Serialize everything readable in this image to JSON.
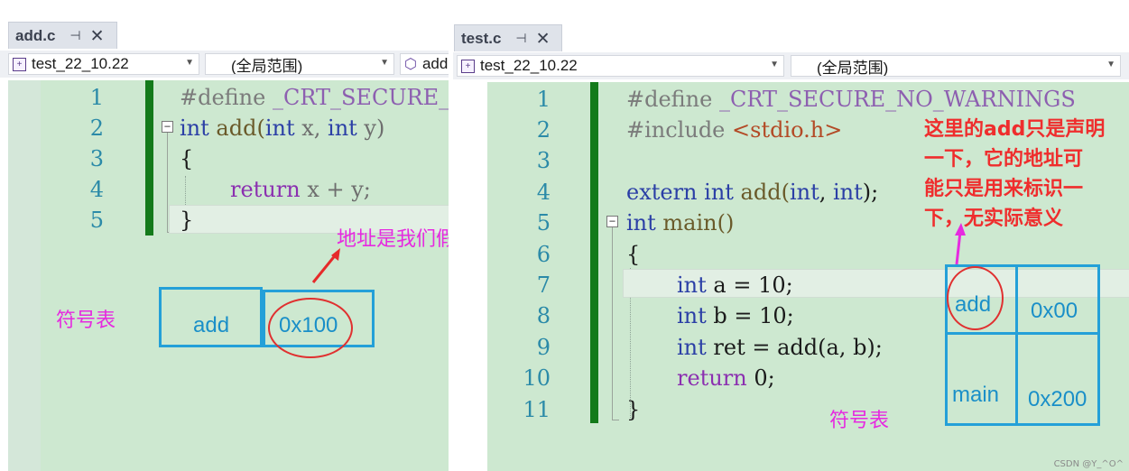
{
  "left_pane": {
    "tab": {
      "title": "add.c",
      "pin_glyph": "⊣",
      "close_glyph": "✕"
    },
    "nav": {
      "project": "test_22_10.22",
      "scope": "(全局范围)",
      "member": "add"
    },
    "lines": [
      "1",
      "2",
      "3",
      "4",
      "5"
    ],
    "code": {
      "l1_define": "#define",
      "l1_macro": " _CRT_SECURE_NO_WARNINGS",
      "l2_int": "int",
      "l2_fn": " add(",
      "l2_int2": "int",
      "l2_x": " x, ",
      "l2_int3": "int",
      "l2_y": " y)",
      "l3": "{",
      "l4_return": "return",
      "l4_expr": " x + y;",
      "l5": "}"
    },
    "annotation": {
      "note": "地址是我们假设的",
      "symtab_label": "符号表",
      "sym_name": "add",
      "sym_addr": "0x100"
    }
  },
  "right_pane": {
    "tab": {
      "title": "test.c",
      "pin_glyph": "⊣",
      "close_glyph": "✕"
    },
    "nav": {
      "project": "test_22_10.22",
      "scope": "(全局范围)"
    },
    "lines": [
      "1",
      "2",
      "3",
      "4",
      "5",
      "6",
      "7",
      "8",
      "9",
      "10",
      "11"
    ],
    "code": {
      "l1_define": "#define",
      "l1_macro": " _CRT_SECURE_NO_WARNINGS",
      "l2_include": "#include",
      "l2_header": " <stdio.h>",
      "l4_extern": "extern",
      "l4_int": " int",
      "l4_fn": " add(",
      "l4_int2": "int",
      "l4_comma": ", ",
      "l4_int3": "int",
      "l4_end": ");",
      "l5_int": "int",
      "l5_main": " main()",
      "l6": "{",
      "l7_int": "int",
      "l7_rest": " a = 10;",
      "l8_int": "int",
      "l8_rest": " b = 10;",
      "l9_int": "int",
      "l9_rest": " ret = add(a, b);",
      "l10_return": "return",
      "l10_rest": " 0;",
      "l11": "}"
    },
    "annotation": {
      "note_lines": [
        "这里的add只是声明",
        "一下，它的地址可",
        "能只是用来标识一",
        "下，无实际意义"
      ],
      "symtab_label": "符号表",
      "sym1_name": "add",
      "sym1_addr": "0x00",
      "sym2_name": "main",
      "sym2_addr": "0x200"
    }
  },
  "watermark": "CSDN @Y_^O^",
  "colors": {
    "editor_bg": "#cde8d0",
    "change_bar": "#137a1a",
    "keyword": "#2b3fa6",
    "symbol_box": "#24a0d8",
    "annotation_magenta": "#e62ae0",
    "annotation_red": "#ef2d2d"
  }
}
